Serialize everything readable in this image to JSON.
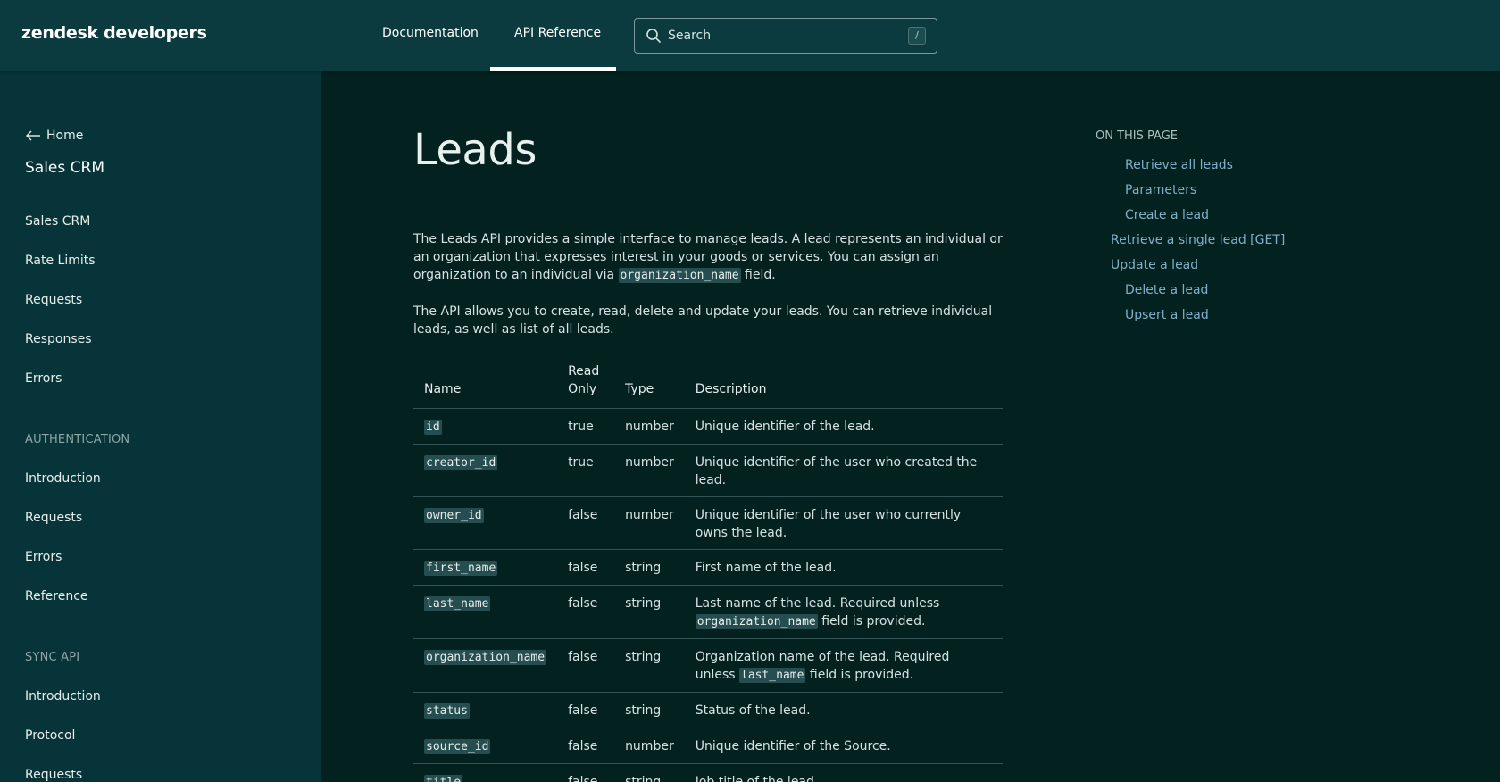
{
  "header": {
    "logo": "zendesk developers",
    "nav": {
      "documentation": "Documentation",
      "api_reference": "API Reference"
    },
    "search": {
      "placeholder": "Search",
      "shortcut": "/"
    }
  },
  "sidebar": {
    "home": "Home",
    "title": "Sales CRM",
    "items": [
      "Sales CRM",
      "Rate Limits",
      "Requests",
      "Responses",
      "Errors"
    ],
    "sections": [
      {
        "heading": "AUTHENTICATION",
        "items": [
          "Introduction",
          "Requests",
          "Errors",
          "Reference"
        ]
      },
      {
        "heading": "SYNC API",
        "items": [
          "Introduction",
          "Protocol",
          "Requests"
        ]
      }
    ]
  },
  "main": {
    "title": "Leads",
    "intro": {
      "before_code": "The Leads API provides a simple interface to manage leads. A lead represents an individual or an organization that expresses interest in your goods or services. You can assign an organization to an individual via ",
      "code": "organization_name",
      "after_code": " field."
    },
    "intro2": "The API allows you to create, read, delete and update your leads. You can retrieve individual leads, as well as list of all leads.",
    "table": {
      "headers": {
        "name": "Name",
        "read_only": "Read Only",
        "type": "Type",
        "description": "Description"
      },
      "rows": [
        {
          "name": "id",
          "read_only": "true",
          "type": "number",
          "desc_before": "Unique identifier of the lead.",
          "desc_code": "",
          "desc_after": ""
        },
        {
          "name": "creator_id",
          "read_only": "true",
          "type": "number",
          "desc_before": "Unique identifier of the user who created the lead.",
          "desc_code": "",
          "desc_after": ""
        },
        {
          "name": "owner_id",
          "read_only": "false",
          "type": "number",
          "desc_before": "Unique identifier of the user who currently owns the lead.",
          "desc_code": "",
          "desc_after": ""
        },
        {
          "name": "first_name",
          "read_only": "false",
          "type": "string",
          "desc_before": "First name of the lead.",
          "desc_code": "",
          "desc_after": ""
        },
        {
          "name": "last_name",
          "read_only": "false",
          "type": "string",
          "desc_before": "Last name of the lead. Required unless ",
          "desc_code": "organization_name",
          "desc_after": " field is provided."
        },
        {
          "name": "organization_name",
          "read_only": "false",
          "type": "string",
          "desc_before": "Organization name of the lead. Required unless ",
          "desc_code": "last_name",
          "desc_after": " field is provided."
        },
        {
          "name": "status",
          "read_only": "false",
          "type": "string",
          "desc_before": "Status of the lead.",
          "desc_code": "",
          "desc_after": ""
        },
        {
          "name": "source_id",
          "read_only": "false",
          "type": "number",
          "desc_before": "Unique identifier of the Source.",
          "desc_code": "",
          "desc_after": ""
        },
        {
          "name": "title",
          "read_only": "false",
          "type": "string",
          "desc_before": "Job title of the lead.",
          "desc_code": "",
          "desc_after": ""
        }
      ]
    }
  },
  "toc": {
    "heading": "ON THIS PAGE",
    "items": [
      {
        "label": "Retrieve all leads",
        "level": 2
      },
      {
        "label": "Parameters",
        "level": 2
      },
      {
        "label": "Create a lead",
        "level": 2
      },
      {
        "label": "Retrieve a single lead [GET]",
        "level": 1
      },
      {
        "label": "Update a lead",
        "level": 1
      },
      {
        "label": "Delete a lead",
        "level": 2
      },
      {
        "label": "Upsert a lead",
        "level": 2
      }
    ]
  },
  "colors": {
    "header_bg": "#0b3a3f",
    "sidebar_bg": "#073438",
    "main_bg": "#03211f",
    "link": "#7fb1ca",
    "code_bg": "#264e50"
  }
}
